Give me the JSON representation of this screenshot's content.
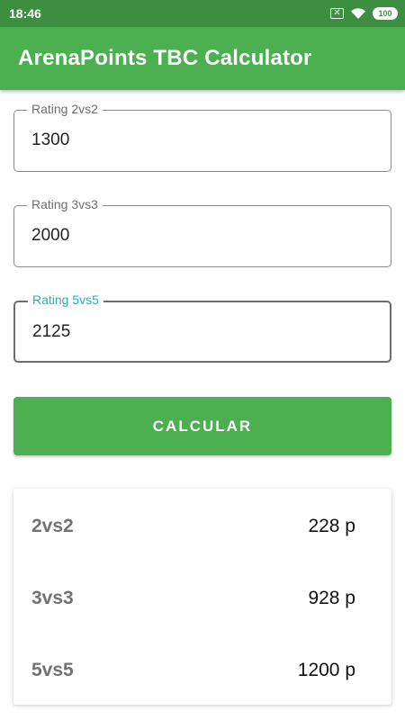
{
  "status_bar": {
    "time": "18:46",
    "battery": "100"
  },
  "app_bar": {
    "title": "ArenaPoints TBC Calculator"
  },
  "form": {
    "fields": [
      {
        "label": "Rating 2vs2",
        "value": "1300"
      },
      {
        "label": "Rating 3vs3",
        "value": "2000"
      },
      {
        "label": "Rating 5vs5",
        "value": "2125",
        "focused": true
      }
    ],
    "submit_label": "CALCULAR"
  },
  "results": [
    {
      "label": "2vs2",
      "value": "228 p"
    },
    {
      "label": "3vs3",
      "value": "928 p"
    },
    {
      "label": "5vs5",
      "value": "1200 p"
    }
  ],
  "colors": {
    "primary": "#4caf50",
    "primary_dark": "#3e8e41",
    "focus_label": "#21b0c2"
  }
}
